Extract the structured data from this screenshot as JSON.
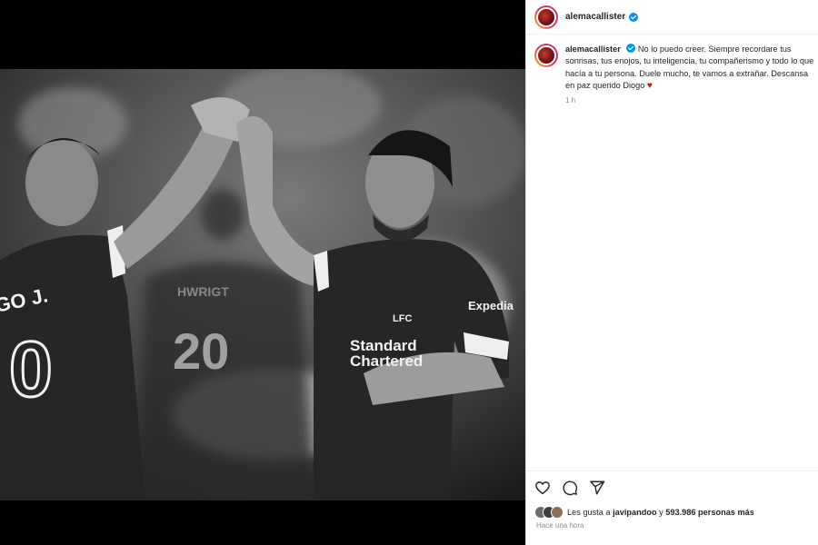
{
  "post": {
    "username": "alemacallister",
    "verified": true,
    "caption_text": "No lo puedo creer. Siempre recordare tus sonrisas, tus enojos, tu inteligencia, tu compañerismo y todo lo que hacía a tu persona. Duele mucho, te vamos a extrañar. Descansa en paz querido Diogo",
    "caption_heart": "♥",
    "time_ago": "1 h",
    "likes_prefix": "Les gusta a",
    "likes_user": "javipandoo",
    "likes_connector": "y",
    "likes_count": "593.986 personas más",
    "posted_ago": "Hace una hora"
  },
  "photo": {
    "sponsor_line1": "Standard",
    "sponsor_line2": "Chartered",
    "club": "LFC",
    "shirt_back_name": "GO J.",
    "shirt_back_number": "20",
    "shirt_left_number": "0",
    "sleeve_sponsor": "Expedia"
  },
  "icons": {
    "like": "heart-outline-icon",
    "comment": "comment-bubble-icon",
    "share": "paper-plane-icon",
    "verified": "verified-badge-icon"
  },
  "colors": {
    "verified": "#0095f6",
    "heart": "#c0101a",
    "muted_text": "#8e8e8e"
  }
}
